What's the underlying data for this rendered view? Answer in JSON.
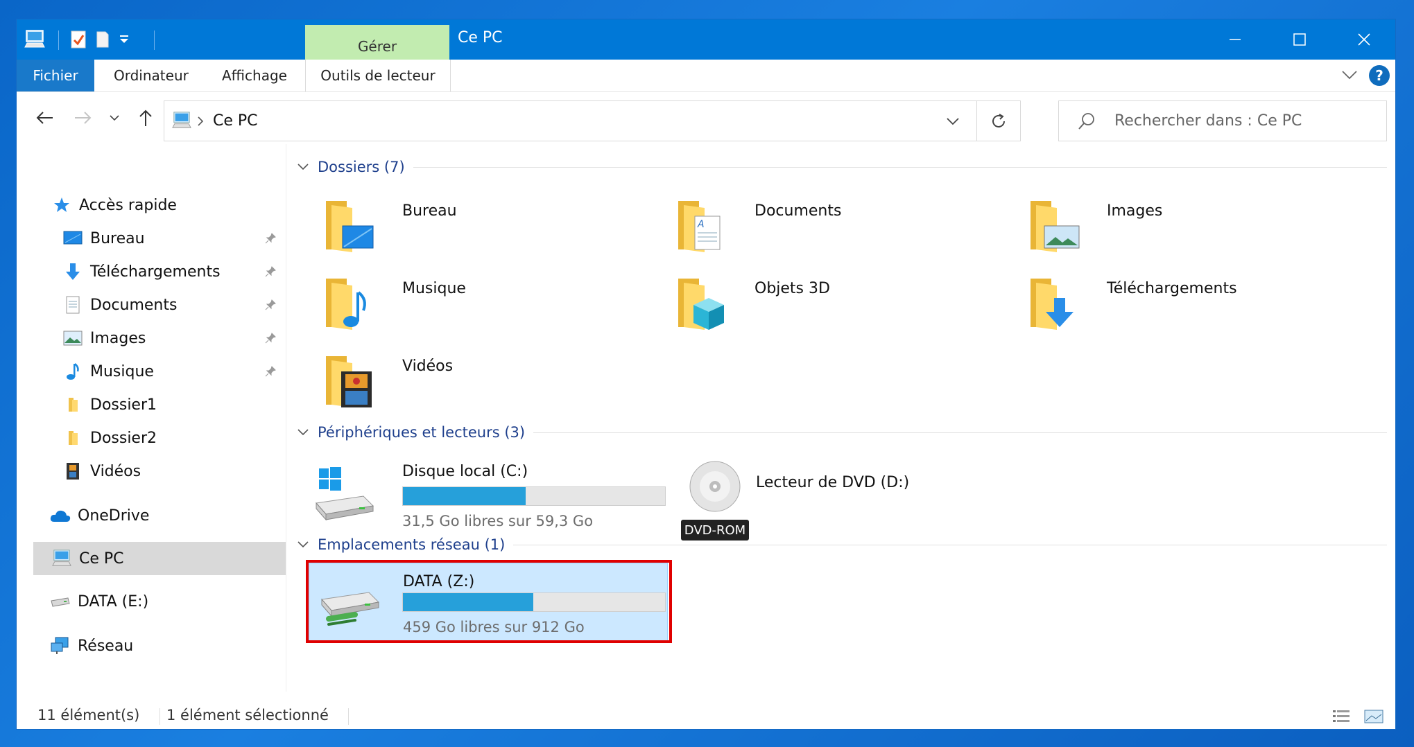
{
  "window": {
    "title": "Ce PC",
    "manage_tab": "Gérer",
    "tabs": [
      "Fichier",
      "Ordinateur",
      "Affichage",
      "Outils de lecteur"
    ]
  },
  "address": {
    "path": "Ce PC",
    "search_placeholder": "Rechercher dans : Ce PC"
  },
  "navpane": {
    "quick_access": "Accès rapide",
    "pinned": [
      {
        "label": "Bureau",
        "icon": "desktop-icon"
      },
      {
        "label": "Téléchargements",
        "icon": "download-icon"
      },
      {
        "label": "Documents",
        "icon": "document-icon"
      },
      {
        "label": "Images",
        "icon": "image-icon"
      },
      {
        "label": "Musique",
        "icon": "music-icon"
      }
    ],
    "folders": [
      "Dossier1",
      "Dossier2",
      "Vidéos"
    ],
    "onedrive": "OneDrive",
    "this_pc": "Ce PC",
    "data_e": "DATA (E:)",
    "network": "Réseau"
  },
  "content": {
    "folders_group": "Dossiers (7)",
    "folders": [
      "Bureau",
      "Documents",
      "Images",
      "Musique",
      "Objets 3D",
      "Téléchargements",
      "Vidéos"
    ],
    "devices_group": "Périphériques et lecteurs (3)",
    "drive_c": {
      "name": "Disque local (C:)",
      "free_text": "31,5 Go libres sur 59,3 Go",
      "used_fraction": 0.469
    },
    "dvd": {
      "name": "Lecteur de DVD (D:)",
      "badge": "DVD-ROM"
    },
    "network_group": "Emplacements réseau (1)",
    "drive_z": {
      "name": "DATA (Z:)",
      "free_text": "459 Go libres sur 912 Go",
      "used_fraction": 0.497
    }
  },
  "status": {
    "count": "11 élément(s)",
    "selection": "1 élément sélectionné"
  },
  "colors": {
    "accent": "#0078d7",
    "manage": "#c2ecb0",
    "selection": "#cce8ff",
    "highlight": "#e00000",
    "bar": "#26a0da"
  }
}
